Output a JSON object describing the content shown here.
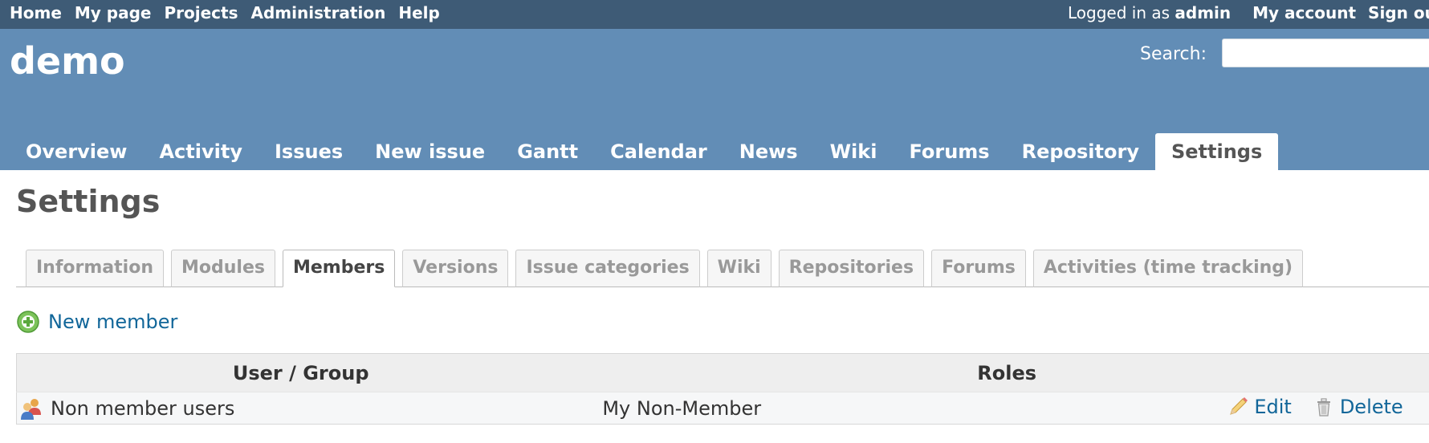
{
  "top_menu": {
    "links": [
      "Home",
      "My page",
      "Projects",
      "Administration",
      "Help"
    ],
    "logged_in_prefix": "Logged in as",
    "logged_in_user": "admin",
    "my_account": "My account",
    "sign_out": "Sign out"
  },
  "header": {
    "project_title": "demo",
    "search_label": "Search:",
    "search_value": ""
  },
  "main_menu": {
    "items": [
      "Overview",
      "Activity",
      "Issues",
      "New issue",
      "Gantt",
      "Calendar",
      "News",
      "Wiki",
      "Forums",
      "Repository",
      "Settings"
    ],
    "selected": "Settings"
  },
  "content": {
    "page_title": "Settings",
    "tabs": [
      "Information",
      "Modules",
      "Members",
      "Versions",
      "Issue categories",
      "Wiki",
      "Repositories",
      "Forums",
      "Activities (time tracking)"
    ],
    "selected_tab": "Members",
    "new_member_label": "New member",
    "table": {
      "headers": [
        "User / Group",
        "Roles"
      ],
      "rows": [
        {
          "user": "Non member users",
          "roles": "My Non-Member",
          "edit_label": "Edit",
          "delete_label": "Delete"
        }
      ]
    }
  },
  "icons": {
    "add": "add-circle-icon",
    "group": "group-icon",
    "edit": "pencil-icon",
    "delete": "trash-icon"
  },
  "colors": {
    "top_menu_bg": "#3e5b76",
    "header_bg": "#628db6",
    "link": "#116699"
  }
}
